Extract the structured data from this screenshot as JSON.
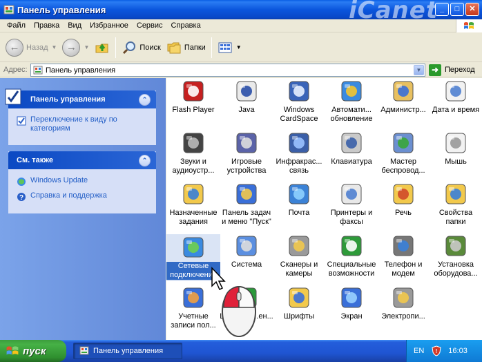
{
  "window": {
    "title": "Панель управления",
    "brand_watermark": "iCanet",
    "controls": [
      "_",
      "□",
      "✕"
    ]
  },
  "menubar": {
    "items": [
      "Файл",
      "Правка",
      "Вид",
      "Избранное",
      "Сервис",
      "Справка"
    ]
  },
  "toolbar": {
    "back_label": "Назад",
    "search_label": "Поиск",
    "folders_label": "Папки"
  },
  "address": {
    "label": "Адрес:",
    "value": "Панель управления",
    "go_label": "Переход"
  },
  "sidebar": {
    "control_panel": {
      "title": "Панель управления",
      "link": "Переключение к виду по категориям"
    },
    "see_also": {
      "title": "См. также",
      "links": [
        "Windows Update",
        "Справка и поддержка"
      ]
    }
  },
  "applets": [
    {
      "label": "Flash Player",
      "icon": "flash-player-icon"
    },
    {
      "label": "Java",
      "icon": "java-icon"
    },
    {
      "label": "Windows CardSpace",
      "icon": "cardspace-icon"
    },
    {
      "label": "Автомати... обновление",
      "icon": "automatic-updates-icon"
    },
    {
      "label": "Админиcтр...",
      "icon": "administrative-tools-icon"
    },
    {
      "label": "Дата и время",
      "icon": "date-time-icon"
    },
    {
      "label": "Звуки и аудиоустр...",
      "icon": "sounds-icon"
    },
    {
      "label": "Игровые устройства",
      "icon": "game-controllers-icon"
    },
    {
      "label": "Инфракрас... связь",
      "icon": "infrared-icon"
    },
    {
      "label": "Клавиатура",
      "icon": "keyboard-icon"
    },
    {
      "label": "Мастер беспровод...",
      "icon": "wireless-wizard-icon"
    },
    {
      "label": "Мышь",
      "icon": "mouse-icon"
    },
    {
      "label": "Назначенные задания",
      "icon": "scheduled-tasks-icon"
    },
    {
      "label": "Панель задач и меню \"Пуск\"",
      "icon": "taskbar-start-menu-icon"
    },
    {
      "label": "Почта",
      "icon": "mail-icon"
    },
    {
      "label": "Принтеры и факсы",
      "icon": "printers-faxes-icon"
    },
    {
      "label": "Речь",
      "icon": "speech-icon"
    },
    {
      "label": "Свойства папки",
      "icon": "folder-options-icon"
    },
    {
      "label": "Сетевые подключения",
      "icon": "network-connections-icon"
    },
    {
      "label": "Система",
      "icon": "system-icon"
    },
    {
      "label": "Сканеры и камеры",
      "icon": "scanners-cameras-icon"
    },
    {
      "label": "Специальные возможности",
      "icon": "accessibility-icon"
    },
    {
      "label": "Телефон и модем",
      "icon": "phone-modem-icon"
    },
    {
      "label": "Установка оборудова...",
      "icon": "add-hardware-icon"
    },
    {
      "label": "Учетные записи пол...",
      "icon": "user-accounts-icon"
    },
    {
      "label": "Центр об...ен...",
      "icon": "security-center-icon"
    },
    {
      "label": "Шрифты",
      "icon": "fonts-icon"
    },
    {
      "label": "Экран",
      "icon": "display-icon"
    },
    {
      "label": "Электропи...",
      "icon": "power-options-icon"
    }
  ],
  "taskbar": {
    "start_label": "пуск",
    "task_label": "Панель управления",
    "language": "EN",
    "clock": "16:03"
  },
  "colors": {
    "title_blue": "#0b56dd",
    "sidebar_blue": "#6f95e0",
    "selection": "#316ac5",
    "start_green": "#3c9e3c",
    "link_blue": "#215dc6"
  }
}
